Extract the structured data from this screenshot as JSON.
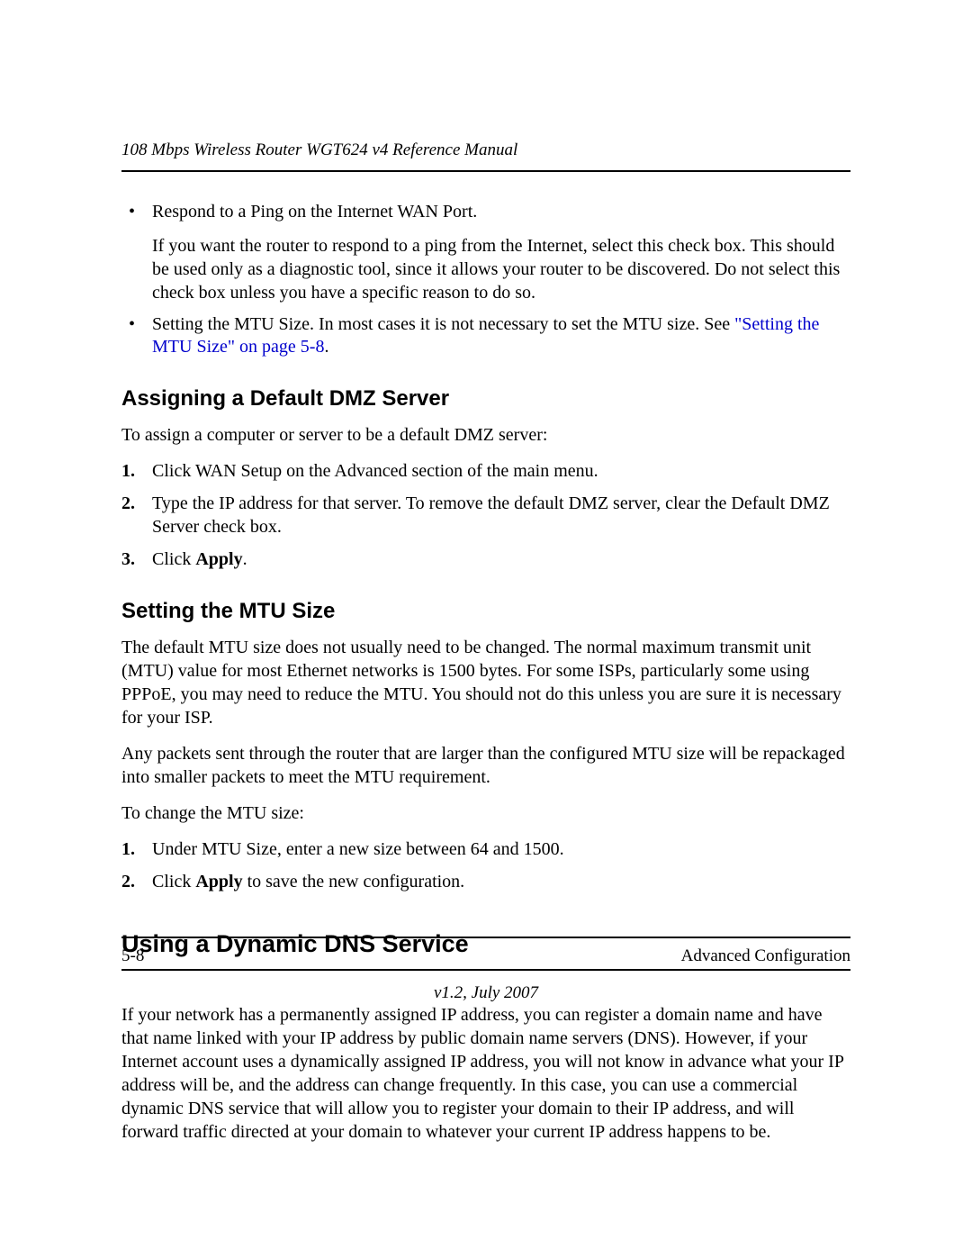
{
  "header": {
    "running_head": "108 Mbps Wireless Router WGT624 v4 Reference Manual"
  },
  "bullets": {
    "item1": {
      "title": "Respond to a Ping on the Internet WAN Port.",
      "body": "If you want the router to respond to a ping from the Internet, select this check box. This should be used only as a diagnostic tool, since it allows your router to be discovered. Do not select this check box unless you have a specific reason to do so."
    },
    "item2": {
      "lead": "Setting the MTU Size. In most cases it is not necessary to set the MTU size. See ",
      "link": "\"Setting the MTU Size\" on page 5-8",
      "tail": "."
    }
  },
  "section_dmz": {
    "heading": "Assigning a Default DMZ Server",
    "intro": "To assign a computer or server to be a default DMZ server:",
    "steps": {
      "n1": "1.",
      "s1": "Click WAN Setup on the Advanced section of the main menu.",
      "n2": "2.",
      "s2": "Type the IP address for that server. To remove the default DMZ server, clear the Default DMZ Server check box.",
      "n3": "3.",
      "s3_a": "Click ",
      "s3_b": "Apply",
      "s3_c": "."
    }
  },
  "section_mtu": {
    "heading": "Setting the MTU Size",
    "p1": "The default MTU size does not usually need to be changed. The normal maximum transmit unit (MTU) value for most Ethernet networks is 1500 bytes. For some ISPs, particularly some using PPPoE, you may need to reduce the MTU. You should not do this unless you are sure it is necessary for your ISP.",
    "p2": "Any packets sent through the router that are larger than the configured MTU size will be repackaged into smaller packets to meet the MTU requirement.",
    "p3": "To change the MTU size:",
    "steps": {
      "n1": "1.",
      "s1": "Under MTU Size, enter a new size between 64 and 1500.",
      "n2": "2.",
      "s2_a": "Click ",
      "s2_b": "Apply",
      "s2_c": " to save the new configuration."
    }
  },
  "section_ddns": {
    "heading": "Using a Dynamic DNS Service",
    "p1": "If your network has a permanently assigned IP address, you can register a domain name and have that name linked with your IP address by public domain name servers (DNS). However, if your Internet account uses a dynamically assigned IP address, you will not know in advance what your IP address will be, and the address can change frequently. In this case, you can use a commercial dynamic DNS service that will allow you to register your domain to their IP address, and will forward traffic directed at your domain to whatever your current IP address happens to be."
  },
  "footer": {
    "page_num": "5-8",
    "section": "Advanced Configuration",
    "version": "v1.2, July 2007"
  }
}
